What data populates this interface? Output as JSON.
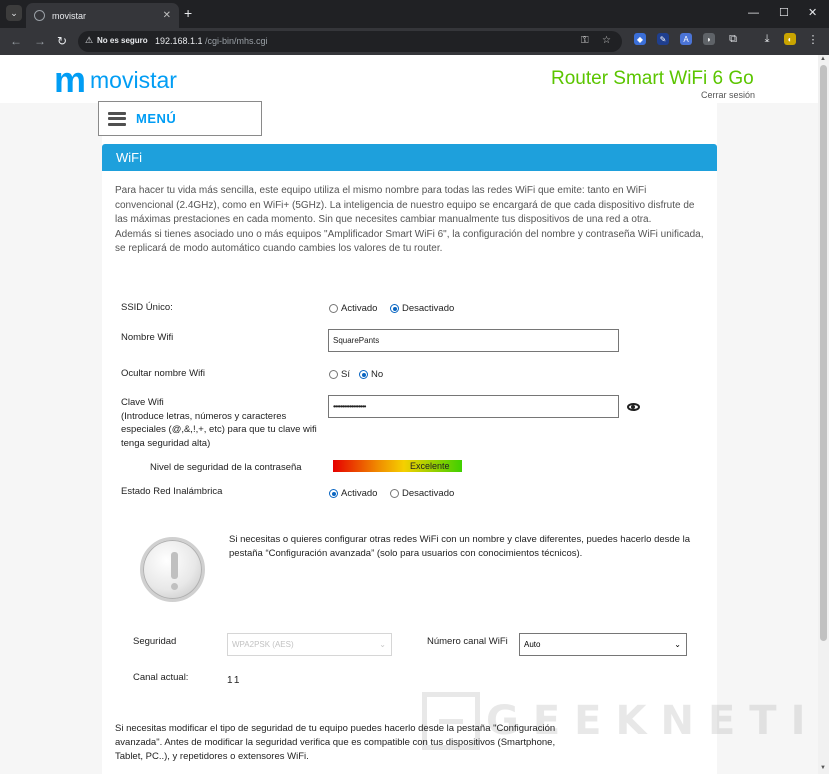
{
  "browser": {
    "tab_title": "movistar",
    "tab_close": "✕",
    "new_tab": "+",
    "minimize": "—",
    "maximize": "☐",
    "close": "✕",
    "security_label": "No es seguro",
    "url_host": "192.168.1.1",
    "url_path": "/cgi-bin/mhs.cgi"
  },
  "header": {
    "brand_mark": "m",
    "brand_name": "movistar",
    "product_title": "Router Smart WiFi 6 Go",
    "logout": "Cerrar sesión"
  },
  "menu": {
    "label": "MENÚ"
  },
  "section": {
    "title": "WiFi"
  },
  "intro": {
    "p1": "Para hacer tu vida más sencilla, este equipo utiliza el mismo nombre para todas las redes WiFi que emite: tanto en WiFi convencional (2.4GHz), como en WiFi+ (5GHz). La inteligencia de nuestro equipo se encargará de que cada dispositivo disfrute de las máximas prestaciones en cada momento. Sin que necesites cambiar manualmente tus dispositivos de una red a otra.",
    "p2": "Además si tienes asociado uno o más equipos \"Amplificador Smart WiFi 6\", la configuración del nombre y contraseña WiFi unificada, se replicará de modo automático cuando cambies los valores de tu router."
  },
  "form": {
    "ssid_label": "SSID Único:",
    "ssid_on": "Activado",
    "ssid_off": "Desactivado",
    "ssid_selected": "off",
    "wifi_name_label": "Nombre Wifi",
    "wifi_name_value": "SquarePants",
    "hide_label": "Ocultar nombre Wifi",
    "hide_yes": "Sí",
    "hide_no": "No",
    "hide_selected": "no",
    "key_label": "Clave Wifi",
    "key_hint": "(Introduce letras, números y caracteres especiales (@,&,!,+, etc) para que tu clave wifi tenga seguridad alta)",
    "key_value": "••••••••••••••••••",
    "strength_label": "Nivel de seguridad de la contraseña",
    "strength_value": "Excelente",
    "strength_level": 1.0,
    "wireless_label": "Estado Red Inalámbrica",
    "wireless_on": "Activado",
    "wireless_off": "Desactivado",
    "wireless_selected": "on"
  },
  "advanced_note": "Si necesitas o quieres configurar otras redes WiFi con un nombre y clave diferentes, puedes hacerlo desde la pestaña “Configuración avanzada” (solo para usuarios con conocimientos técnicos).",
  "security": {
    "label": "Seguridad",
    "value": "WPA2PSK (AES)",
    "channel_label": "Número canal WiFi",
    "channel_value": "Auto",
    "current_channel_label": "Canal actual:",
    "current_channel_value": "11"
  },
  "footer_note": "Si necesitas modificar el tipo de seguridad de tu equipo puedes hacerlo desde la pestaña \"Configuración avanzada\". Antes de modificar la seguridad verifica que es compatible con tus dispositivos (Smartphone, Tablet, PC..), y repetidores o extensores WiFi.",
  "watermark": "GEEKNETIC",
  "colors": {
    "brand_blue": "#019df4",
    "brand_green": "#5bc500",
    "section_bar": "#1ea0dc"
  }
}
